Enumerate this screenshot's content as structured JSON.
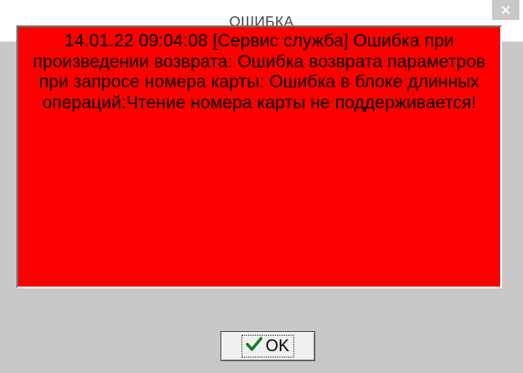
{
  "window": {
    "title": "ОШИБКА"
  },
  "message": {
    "text": "14.01.22 09:04:08 [Сервис служба] Ошибка при произведении возврата: Ошибка возврата параметров при запросе номера карты: Ошибка в блоке длинных операций:Чтение номера карты не поддерживается!",
    "background_color": "#ff0000"
  },
  "buttons": {
    "ok_label": "OK",
    "ok_icon": "checkmark-icon",
    "close_icon": "close-icon"
  },
  "colors": {
    "checkmark": "#1a7f1a",
    "dialog_body": "#d4d4d4"
  }
}
